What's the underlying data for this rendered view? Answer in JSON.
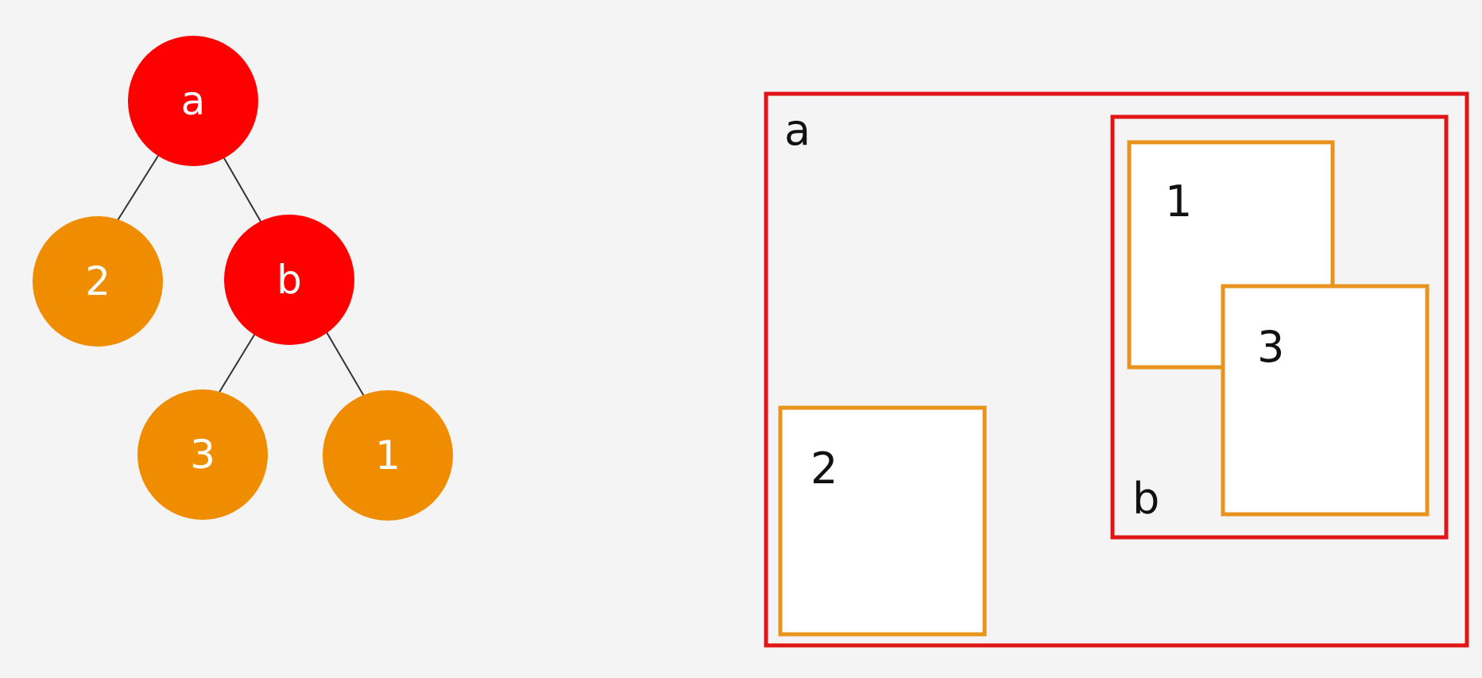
{
  "colors": {
    "background": "#f4f4f4",
    "container_node": "#ff0000",
    "leaf_node": "#f08c00",
    "container_border": "#e01616",
    "leaf_border": "#e8941c",
    "leaf_fill": "#ffffff",
    "edge": "#333333"
  },
  "tree": {
    "nodes": [
      {
        "id": "a",
        "label": "a",
        "kind": "container"
      },
      {
        "id": "n2",
        "label": "2",
        "kind": "leaf"
      },
      {
        "id": "b",
        "label": "b",
        "kind": "container"
      },
      {
        "id": "n3",
        "label": "3",
        "kind": "leaf"
      },
      {
        "id": "n1",
        "label": "1",
        "kind": "leaf"
      }
    ],
    "edges": [
      {
        "from": "a",
        "to": "n2"
      },
      {
        "from": "a",
        "to": "b"
      },
      {
        "from": "b",
        "to": "n3"
      },
      {
        "from": "b",
        "to": "n1"
      }
    ]
  },
  "nesting": {
    "outer_container_label": "a",
    "inner_container_label": "b",
    "leaf_box_labels": {
      "box_2": "2",
      "box_1": "1",
      "box_3": "3"
    }
  }
}
